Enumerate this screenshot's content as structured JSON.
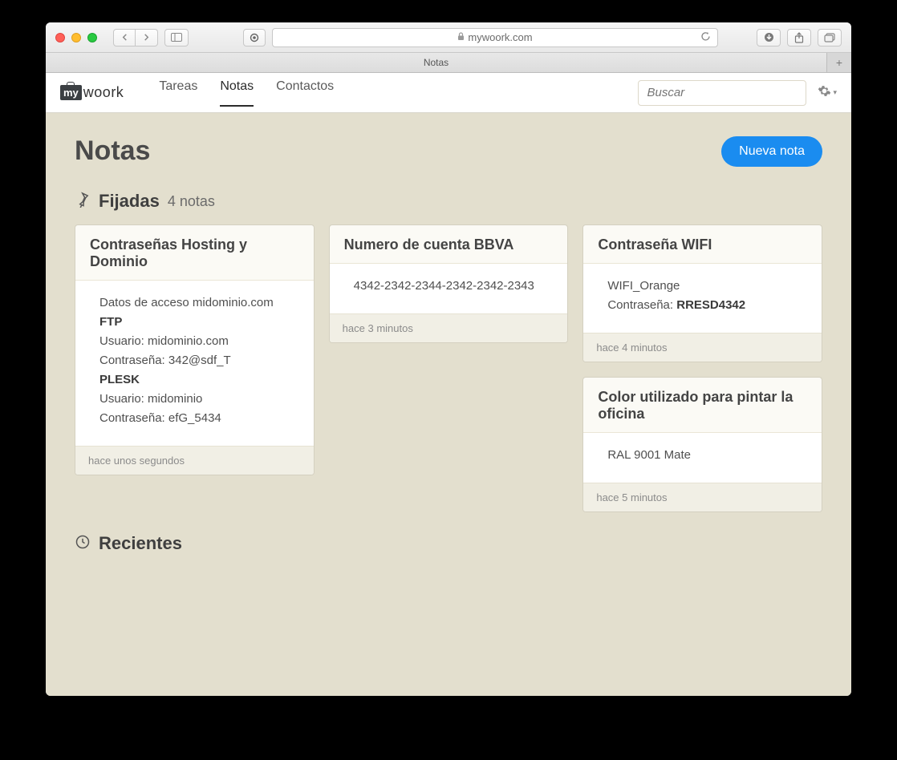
{
  "browser": {
    "url_host": "mywoork.com",
    "tab_title": "Notas"
  },
  "header": {
    "logo_box": "my",
    "logo_text": "woork",
    "nav": [
      {
        "label": "Tareas",
        "active": false
      },
      {
        "label": "Notas",
        "active": true
      },
      {
        "label": "Contactos",
        "active": false
      }
    ],
    "search_placeholder": "Buscar"
  },
  "page": {
    "title": "Notas",
    "new_button": "Nueva nota"
  },
  "pinned": {
    "title": "Fijadas",
    "count_label": "4 notas"
  },
  "notes": [
    {
      "title": "Contraseñas Hosting y Dominio",
      "body_lines": [
        {
          "text": "Datos de acceso midominio.com"
        },
        {
          "text": "FTP",
          "bold": true
        },
        {
          "text": "Usuario: midominio.com"
        },
        {
          "text": "Contraseña: 342@sdf_T"
        },
        {
          "text": "PLESK",
          "bold": true
        },
        {
          "text": "Usuario: midominio"
        },
        {
          "text": "Contraseña: efG_5434"
        }
      ],
      "time": "hace unos segundos"
    },
    {
      "title": "Numero de cuenta BBVA",
      "body_lines": [
        {
          "text": "4342-2342-2344-2342-2342-2343"
        }
      ],
      "time": "hace 3 minutos"
    },
    {
      "title": "Contraseña WIFI",
      "body_lines": [
        {
          "text": "WIFI_Orange"
        },
        {
          "prefix": "Contraseña: ",
          "bold_text": "RRESD4342"
        }
      ],
      "time": "hace 4 minutos"
    },
    {
      "title": "Color utilizado para pintar la oficina",
      "body_lines": [
        {
          "text": "RAL 9001 Mate"
        }
      ],
      "time": "hace 5 minutos"
    }
  ],
  "recent": {
    "title": "Recientes"
  }
}
